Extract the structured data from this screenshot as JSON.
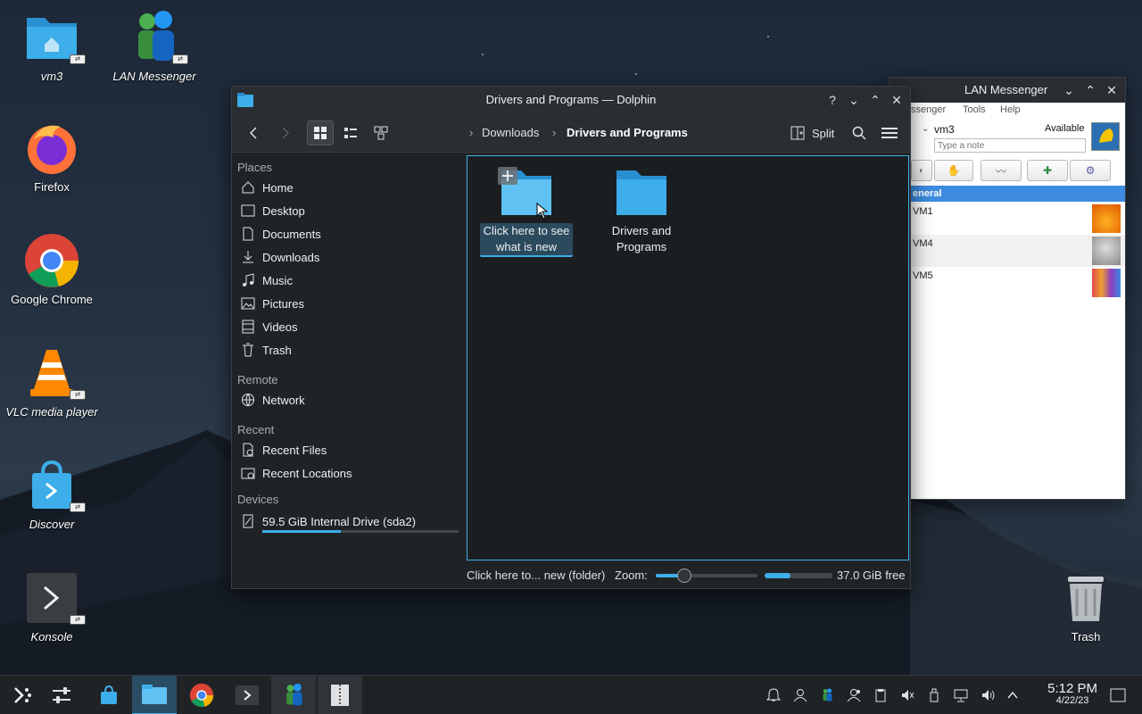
{
  "desktop": {
    "icons": [
      {
        "label": "vm3"
      },
      {
        "label": "LAN Messenger"
      },
      {
        "label": "Firefox"
      },
      {
        "label": "Google Chrome"
      },
      {
        "label": "VLC media player"
      },
      {
        "label": "Discover"
      },
      {
        "label": "Konsole"
      },
      {
        "label": "Trash"
      }
    ]
  },
  "dolphin": {
    "title": "Drivers and Programs — Dolphin",
    "breadcrumb": [
      "Downloads",
      "Drivers and Programs"
    ],
    "split_label": "Split",
    "sections": {
      "places": "Places",
      "remote": "Remote",
      "recent": "Recent",
      "devices": "Devices"
    },
    "places": [
      "Home",
      "Desktop",
      "Documents",
      "Downloads",
      "Music",
      "Pictures",
      "Videos",
      "Trash"
    ],
    "remote": [
      "Network"
    ],
    "recent": [
      "Recent Files",
      "Recent Locations"
    ],
    "devices": [
      {
        "label": "59.5 GiB Internal Drive (sda2)",
        "usage_fraction": 0.4
      }
    ],
    "files": [
      {
        "line1": "Click here to see",
        "line2": "what is new",
        "selected": true
      },
      {
        "line1": "Drivers and",
        "line2": "Programs",
        "selected": false
      }
    ],
    "status": {
      "text": "Click here to... new (folder)",
      "zoom_label": "Zoom:",
      "zoom_fraction": 0.28,
      "free_fraction": 0.38,
      "free_text": "37.0 GiB free"
    }
  },
  "lan": {
    "title": "LAN Messenger",
    "menu": [
      "ssenger",
      "Tools",
      "Help"
    ],
    "user": "vm3",
    "status": "Available",
    "note_placeholder": "Type a note",
    "group": "eneral",
    "contacts": [
      "VM1",
      "VM4",
      "VM5"
    ]
  },
  "clock": {
    "time": "5:12 PM",
    "date": "4/22/23"
  },
  "colors": {
    "accent": "#3daee9",
    "window": "#202326",
    "folder": "#3daee9"
  }
}
